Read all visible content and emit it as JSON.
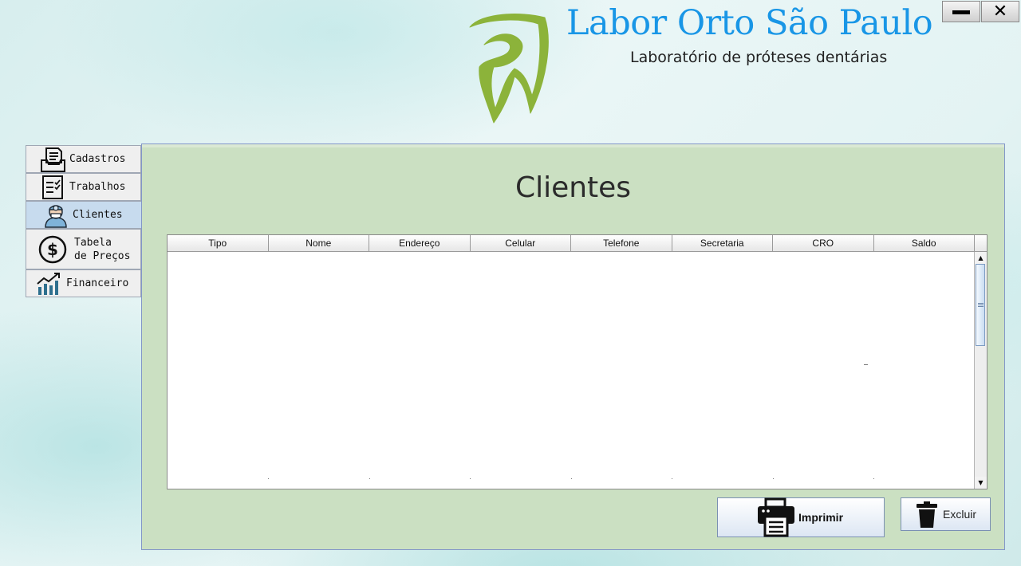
{
  "window": {
    "minimize_icon": "minimize-icon",
    "close_icon": "close-icon",
    "close_glyph": "✕"
  },
  "header": {
    "title": "Labor Orto São Paulo",
    "subtitle": "Laboratório de próteses dentárias",
    "logo_icon": "tooth-logo-icon",
    "title_color": "#1996e6",
    "logo_color": "#8cb33a"
  },
  "sidebar": {
    "active_index": 2,
    "items": [
      {
        "label": "Cadastros",
        "icon": "register-icon"
      },
      {
        "label": "Trabalhos",
        "icon": "checklist-icon"
      },
      {
        "label": "Clientes",
        "icon": "dentist-icon"
      },
      {
        "label": "Tabela\nde Preços",
        "icon": "dollar-icon"
      },
      {
        "label": "Financeiro",
        "icon": "chart-growth-icon"
      }
    ]
  },
  "main": {
    "title": "Clientes",
    "panel_color": "#cbe0c2",
    "table": {
      "columns": [
        "Tipo",
        "Nome",
        "Endereço",
        "Celular",
        "Telefone",
        "Secretaria",
        "CRO",
        "Saldo"
      ],
      "rows": []
    },
    "buttons": {
      "print_label": "Imprimir",
      "print_icon": "printer-icon",
      "delete_label": "Excluir",
      "delete_icon": "trash-icon"
    }
  }
}
